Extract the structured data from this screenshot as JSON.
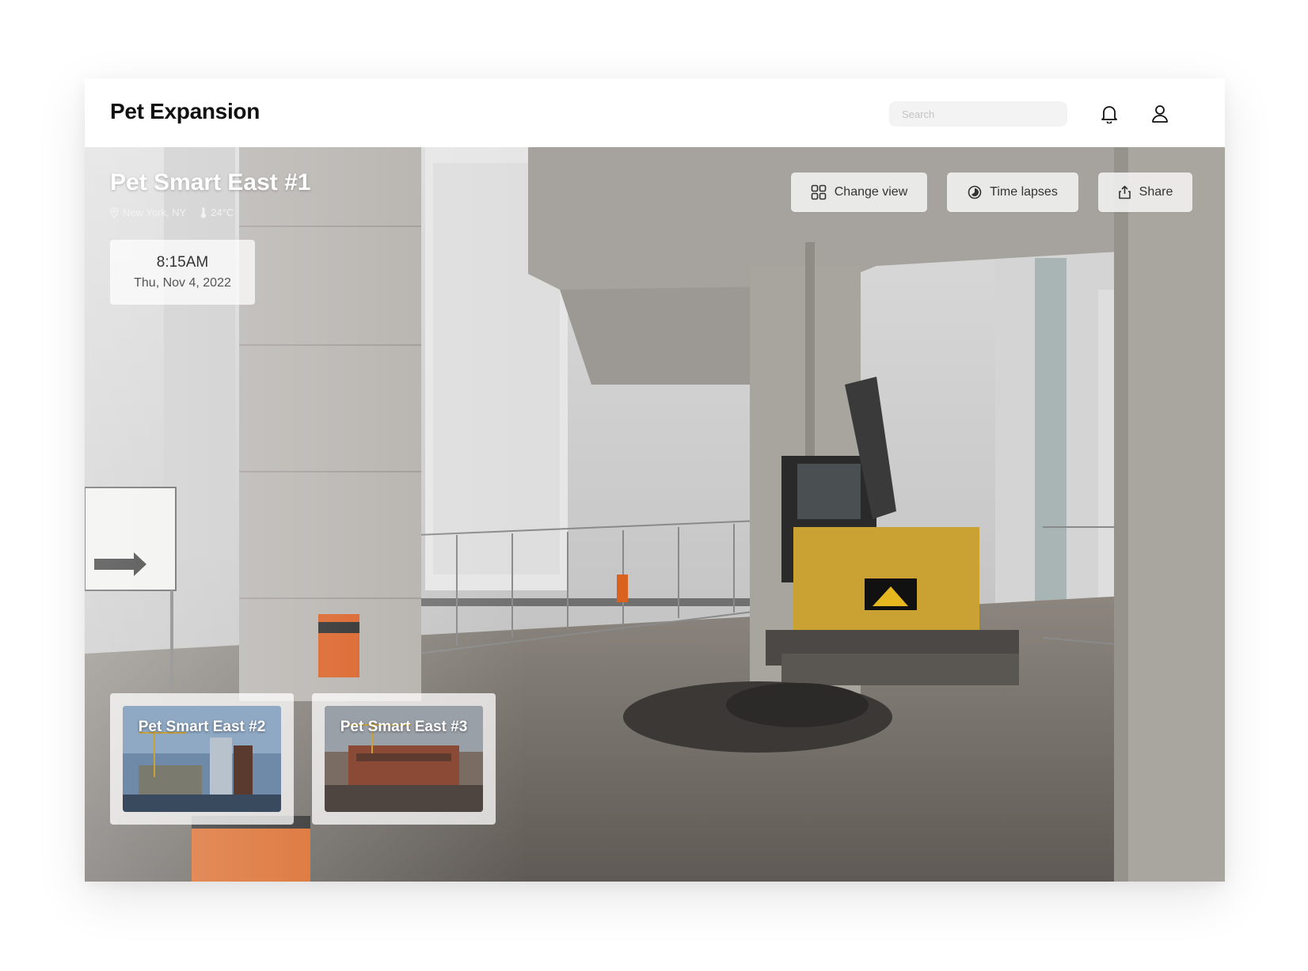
{
  "app": {
    "title": "Pet Expansion",
    "search_placeholder": "Search",
    "icons": {
      "notifications": "bell-icon",
      "profile": "user-icon"
    }
  },
  "camera": {
    "name": "Pet Smart East #1",
    "location": "New York, NY",
    "temperature": "24°C",
    "time": "8:15AM",
    "date": "Thu, Nov 4, 2022"
  },
  "actions": {
    "change_view": "Change view",
    "time_lapses": "Time lapses",
    "share": "Share"
  },
  "other_cameras": [
    {
      "name": "Pet Smart East #2"
    },
    {
      "name": "Pet Smart East #3"
    }
  ],
  "colors": {
    "brand_text": "#111111",
    "button_bg": "#f4f4f4",
    "excavator": "#c9a233"
  }
}
